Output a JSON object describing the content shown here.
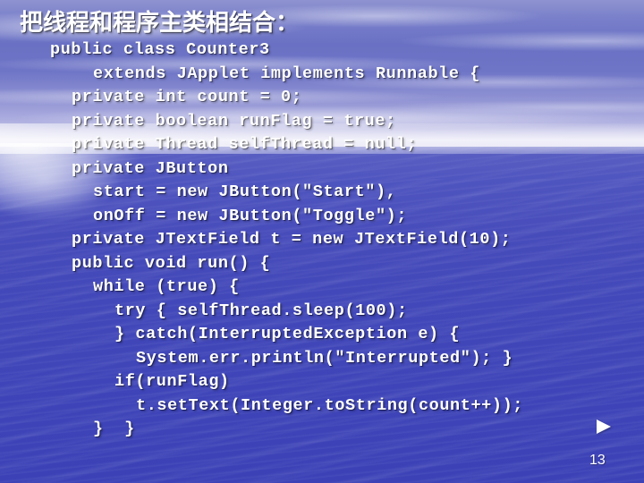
{
  "slide": {
    "title": "把线程和程序主类相结合：",
    "page_number": "13",
    "next_arrow_icon": "play-triangle-right-icon",
    "background": {
      "description": "sky-and-sea-photograph",
      "sky_color": "#6e74c6",
      "sea_color": "#4248b9",
      "horizon_glow_color": "#ffffff",
      "text_color": "#ffffff"
    }
  },
  "code": {
    "language": "java",
    "lines": [
      {
        "indent": 56,
        "text": "public class Counter3"
      },
      {
        "indent": 104,
        "text": "extends JApplet implements Runnable {"
      },
      {
        "indent": 80,
        "text": "private int count = 0;"
      },
      {
        "indent": 80,
        "text": "private boolean runFlag = true;"
      },
      {
        "indent": 80,
        "text": "private Thread selfThread = null;"
      },
      {
        "indent": 80,
        "text": "private JButton"
      },
      {
        "indent": 104,
        "text": "start = new JButton(\"Start\"),"
      },
      {
        "indent": 104,
        "text": "onOff = new JButton(\"Toggle\");"
      },
      {
        "indent": 80,
        "text": "private JTextField t = new JTextField(10);"
      },
      {
        "indent": 80,
        "text": "public void run() {"
      },
      {
        "indent": 104,
        "text": "while (true) {"
      },
      {
        "indent": 128,
        "text": "try { selfThread.sleep(100);"
      },
      {
        "indent": 128,
        "text": "} catch(InterruptedException e) {"
      },
      {
        "indent": 152,
        "text": "System.err.println(\"Interrupted\"); }"
      },
      {
        "indent": 128,
        "text": "if(runFlag)"
      },
      {
        "indent": 152,
        "text": "t.setText(Integer.toString(count++));"
      },
      {
        "indent": 104,
        "text": "}  }"
      }
    ]
  }
}
